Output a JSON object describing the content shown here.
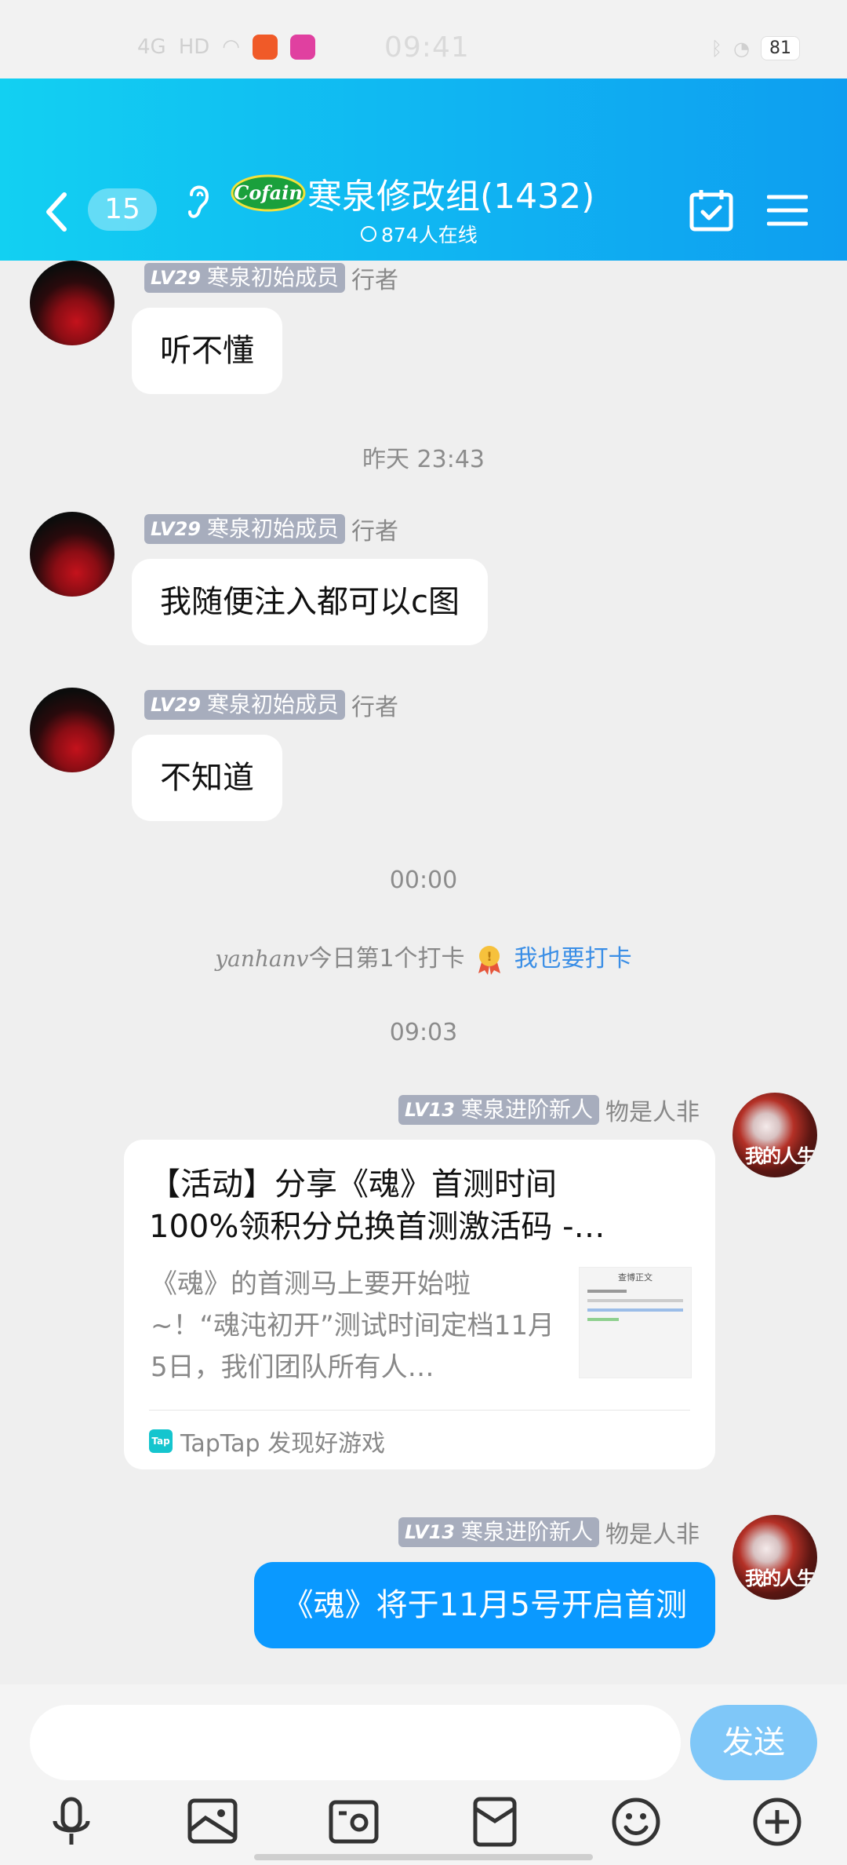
{
  "status_bar": {
    "network": "4G",
    "hd": "HD",
    "time": "09:41",
    "battery": "81",
    "colors": {
      "app_icon_1": "#f05a28",
      "app_icon_2": "#e040a0"
    }
  },
  "header": {
    "unread_count": "15",
    "logo_text": "Cofain",
    "group_name": "寒泉修改组(1432)",
    "online_text": "874人在线",
    "background_color": "#12b8f2"
  },
  "messages": [
    {
      "badge_level": "LV29",
      "badge_title": "寒泉初始成员",
      "nickname": "行者",
      "text": "听不懂"
    },
    {
      "badge_level": "LV29",
      "badge_title": "寒泉初始成员",
      "nickname": "行者",
      "text": "我随便注入都可以c图"
    },
    {
      "badge_level": "LV29",
      "badge_title": "寒泉初始成员",
      "nickname": "行者",
      "text": "不知道"
    },
    {
      "badge_level": "LV13",
      "badge_title": "寒泉进阶新人",
      "nickname": "物是人非",
      "text": "《魂》将于11月5号开启首测"
    }
  ],
  "time_separators": [
    "昨天 23:43",
    "00:00",
    "09:03"
  ],
  "checkin": {
    "user": "yanhanv",
    "text": "今日第1个打卡",
    "link": "我也要打卡"
  },
  "card": {
    "badge_level": "LV13",
    "badge_title": "寒泉进阶新人",
    "nickname": "物是人非",
    "title_line1": "【活动】分享《魂》首测时间",
    "title_line2": "100%领积分兑换首测激活码 -…",
    "description": "《魂》的首测马上要开始啦~！“魂沌初开”测试时间定档11月5日，我们团队所有人…",
    "thumb_title": "查博正文",
    "source": "TapTap 发现好游戏",
    "source_icon": "Tap"
  },
  "avatar_text": "我的人生",
  "input": {
    "placeholder": "",
    "send_label": "发送"
  },
  "toolbar_icons": [
    "mic-icon",
    "image-icon",
    "camera-icon",
    "red-packet-icon",
    "emoji-icon",
    "plus-icon"
  ],
  "accent_colors": {
    "send_bubble": "#0a99ff",
    "send_button": "#7fc7f8",
    "link": "#3a8ee6"
  }
}
